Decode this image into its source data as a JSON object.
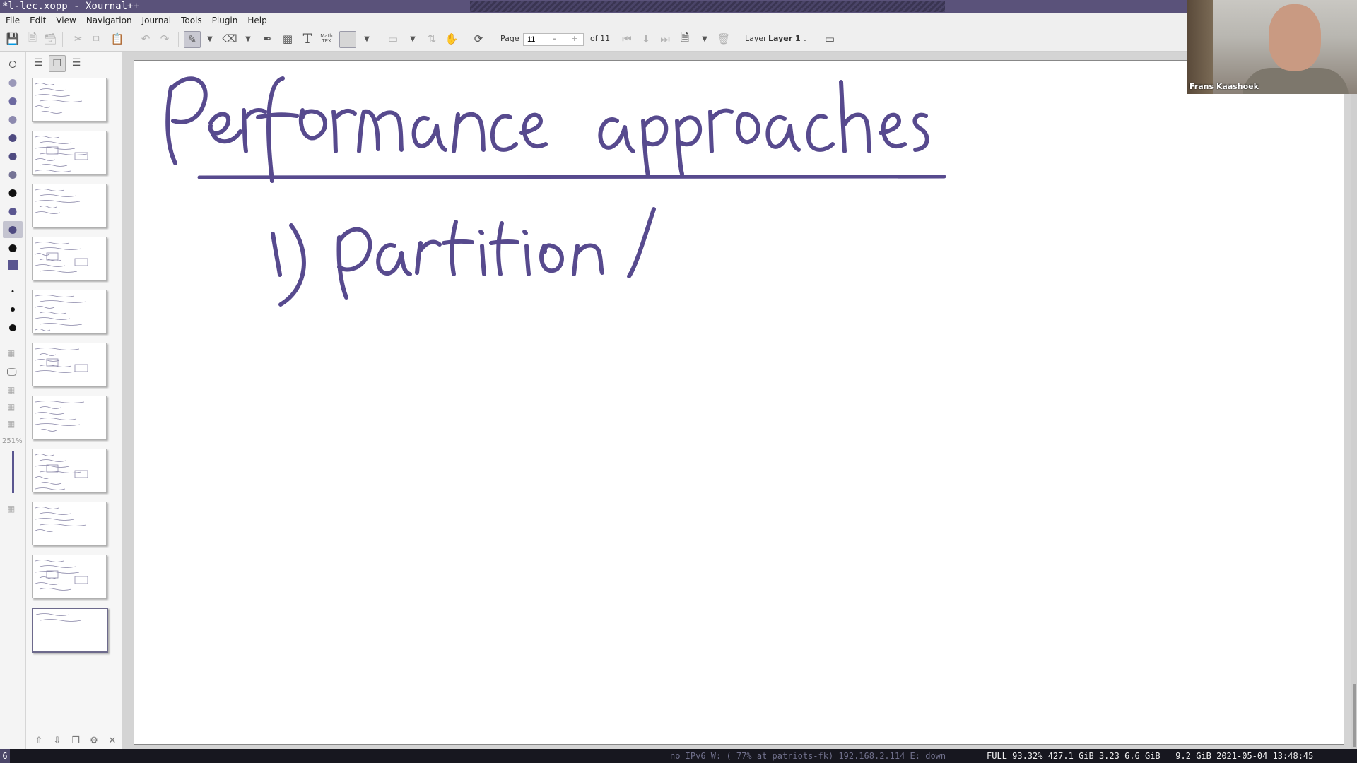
{
  "window": {
    "title": "*l-lec.xopp - Xournal++"
  },
  "menu": [
    "File",
    "Edit",
    "View",
    "Navigation",
    "Journal",
    "Tools",
    "Plugin",
    "Help"
  ],
  "toolbar": {
    "page_label": "Page",
    "page_value": "11",
    "page_minus": "–",
    "page_plus": "+",
    "page_of": "of 11",
    "layer_label": "Layer",
    "layer_value": "Layer 1",
    "math_tex": "Math TEX",
    "text_tool": "T"
  },
  "left_tools": {
    "zoom_label": "251%"
  },
  "sidebar": {
    "thumbnail_count": 11,
    "selected_page": 11
  },
  "page": {
    "ink_lines": [
      "Performance approaches",
      "1) partition /"
    ],
    "ink_color": "#574a8e"
  },
  "webcam": {
    "name": "Frans Kaashoek"
  },
  "statusbar": {
    "workspace": "6",
    "network": "no IPv6 W: ( 77% at patriots-fk) 192.168.2.114 E: down",
    "system": "FULL 93.32% 427.1 GiB 3.23 6.6 GiB | 9.2 GiB 2021-05-04 13:48:45"
  }
}
